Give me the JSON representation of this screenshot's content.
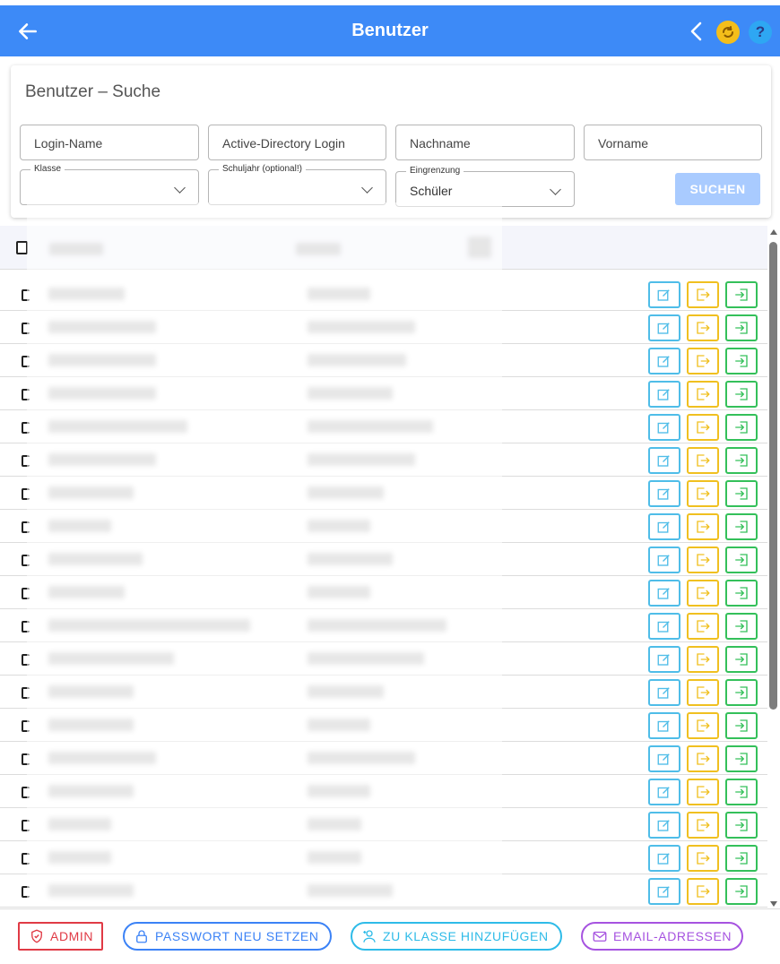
{
  "appbar": {
    "title": "Benutzer",
    "color": "#3d8af7"
  },
  "search": {
    "heading": "Benutzer – Suche",
    "login_placeholder": "Login-Name",
    "ad_placeholder": "Active-Directory Login",
    "nachname_placeholder": "Nachname",
    "vorname_placeholder": "Vorname",
    "klasse_label": "Klasse",
    "klasse_value": "",
    "schuljahr_label": "Schuljahr (optional!)",
    "schuljahr_value": "",
    "eingrenzung_label": "Eingrenzung",
    "eingrenzung_value": "Schüler",
    "search_button": "SUCHEN"
  },
  "table": {
    "row_count": 19,
    "row_actions": [
      "edit-icon",
      "logout-icon",
      "login-icon"
    ]
  },
  "footer": {
    "admin_label": "ADMIN",
    "password_label": "PASSWORT NEU SETZEN",
    "class_label": "ZU KLASSE HINZUFÜGEN",
    "email_label": "EMAIL-ADRESSEN"
  },
  "colors": {
    "edit": "#4fbde8",
    "logout": "#f0c020",
    "login": "#34c05a",
    "admin": "#e03a45"
  }
}
